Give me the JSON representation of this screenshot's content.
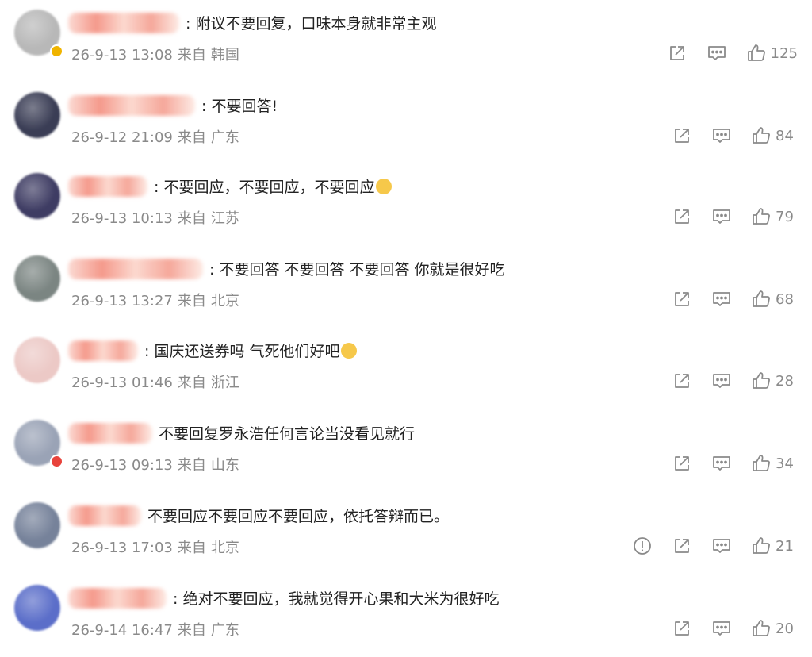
{
  "comments": [
    {
      "text": ": 附议不要回复，口味本身就非常主观",
      "date": "26-9-13 13:08",
      "from": "来自",
      "location": "韩国",
      "likes": "125",
      "report": false,
      "emoji": false,
      "badge": "gold",
      "avatar_color": "#b8b8b8",
      "name_width": 140
    },
    {
      "text": ": 不要回答!",
      "date": "26-9-12 21:09",
      "from": "来自",
      "location": "广东",
      "likes": "84",
      "report": false,
      "emoji": false,
      "badge": "none",
      "avatar_color": "#3a3d55",
      "name_width": 160
    },
    {
      "text": ": 不要回应，不要回应，不要回应",
      "date": "26-9-13 10:13",
      "from": "来自",
      "location": "江苏",
      "likes": "79",
      "report": false,
      "emoji": true,
      "badge": "none",
      "avatar_color": "#3e3c63",
      "name_width": 100
    },
    {
      "text": ": 不要回答 不要回答 不要回答 你就是很好吃",
      "date": "26-9-13 13:27",
      "from": "来自",
      "location": "北京",
      "likes": "68",
      "report": false,
      "emoji": false,
      "badge": "none",
      "avatar_color": "#7b8582",
      "name_width": 170
    },
    {
      "text": ": 国庆还送券吗 气死他们好吧",
      "date": "26-9-13 01:46",
      "from": "来自",
      "location": "浙江",
      "likes": "28",
      "report": false,
      "emoji": true,
      "badge": "none",
      "avatar_color": "#ecc9c6",
      "name_width": 88
    },
    {
      "text": "不要回复罗永浩任何言论当没看见就行",
      "date": "26-9-13 09:13",
      "from": "来自",
      "location": "山东",
      "likes": "34",
      "report": false,
      "emoji": false,
      "badge": "red",
      "avatar_color": "#9aa3b6",
      "name_width": 106
    },
    {
      "text": "不要回应不要回应不要回应，依托答辩而已。",
      "date": "26-9-13 17:03",
      "from": "来自",
      "location": "北京",
      "likes": "21",
      "report": true,
      "emoji": false,
      "badge": "none",
      "avatar_color": "#76829a",
      "name_width": 92
    },
    {
      "text": ": 绝对不要回应，我就觉得开心果和大米为很好吃",
      "date": "26-9-14 16:47",
      "from": "来自",
      "location": "广东",
      "likes": "20",
      "report": false,
      "emoji": false,
      "badge": "none",
      "avatar_color": "#5b6ec9",
      "name_width": 124
    }
  ],
  "icons": {
    "share": "share-icon",
    "comment": "comment-icon",
    "like": "thumb-up-icon",
    "report": "report-icon"
  },
  "colors": {
    "meta": "#8a8a8a",
    "text": "#222222",
    "blur_name": "#f08a78"
  }
}
